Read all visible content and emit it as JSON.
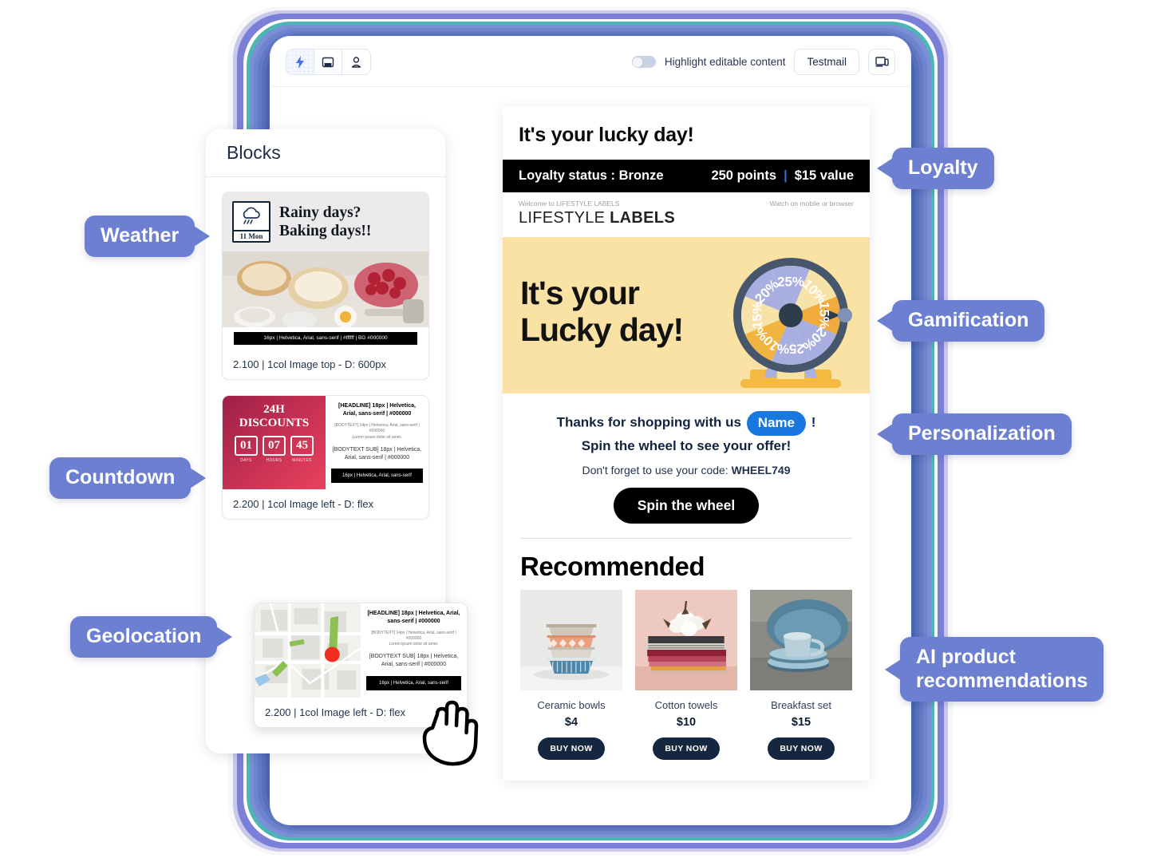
{
  "toolbar": {
    "segments": [
      {
        "name": "bolt-icon",
        "label": "Automation"
      },
      {
        "name": "screen-icon",
        "label": "Desktop preview"
      },
      {
        "name": "person-icon",
        "label": "Personalize"
      }
    ],
    "toggle_label": "Highlight editable content",
    "testmail_label": "Testmail",
    "device_icon_label": "Device preview"
  },
  "blocks_panel": {
    "title": "Blocks",
    "weather_block": {
      "date": "11 Mon",
      "headline_line1": "Rainy days?",
      "headline_line2": "Baking days!!",
      "tag": "16px | Helvetica, Arial, sans-serif | #ffffff | BG #000000",
      "caption": "2.100 | 1col Image top - D: 600px"
    },
    "countdown_block": {
      "title_line1": "24H",
      "title_line2": "DISCOUNTS",
      "units": [
        {
          "value": "01",
          "label": "DAYS"
        },
        {
          "value": "07",
          "label": "HOURS"
        },
        {
          "value": "45",
          "label": "MINUTES"
        }
      ],
      "headline": "[HEADLINE] 18px | Helvetica, Arial, sans-serif | #000000",
      "bodytext": "[BODYTEXT] 14px | Helvetica, Arial, sans-serif | #000000\nLorem ipsum dolor sit amet.",
      "bodytext_sub": "[BODYTEXT SUB] 18px | Helvetica, Arial, sans-serif | #000000",
      "tag": "16px | Helvetica, Arial, sans-serif",
      "caption": "2.200 | 1col Image left - D: flex"
    },
    "geolocation_block": {
      "headline": "[HEADLINE] 18px | Helvetica, Arial, sans-serif | #000000",
      "bodytext": "[BODYTEXT] 14px | Helvetica, Arial, sans-serif | #000000\nLorem ipsum dolor sit amet.",
      "bodytext_sub": "[BODYTEXT SUB] 18px | Helvetica, Arial, sans-serif | #000000",
      "tag": "16px | Helvetica, Arial, sans-serif",
      "caption": "2.200 | 1col Image left - D: flex"
    }
  },
  "email": {
    "hero_title": "It's your lucky day!",
    "loyalty_status": "Loyalty status : Bronze",
    "loyalty_points": "250 points",
    "loyalty_separator": "|",
    "loyalty_value": "$15 value",
    "meta_left": "Welcome to LIFESTYLE LABELS",
    "meta_right": "Watch on mobile or browser",
    "brand_light": "LIFESTYLE",
    "brand_bold": "LABELS",
    "banner_line1": "It's your",
    "banner_line2": "Lucky day!",
    "wheel_segments": [
      "25%",
      "10%",
      "15%",
      "20%",
      "25%",
      "10%",
      "15%",
      "20%"
    ],
    "thanks_prefix": "Thanks for shopping with us",
    "thanks_name_pill": "Name",
    "thanks_suffix": "!",
    "thanks_line2": "Spin the wheel to see your offer!",
    "code_prefix": "Don't forget to use your code:",
    "code_value": "WHEEL749",
    "spin_button": "Spin the wheel",
    "recommended_title": "Recommended",
    "products": [
      {
        "name": "Ceramic bowls",
        "price": "$4",
        "cta": "BUY NOW"
      },
      {
        "name": "Cotton towels",
        "price": "$10",
        "cta": "BUY NOW"
      },
      {
        "name": "Breakfast set",
        "price": "$15",
        "cta": "BUY NOW"
      }
    ]
  },
  "callouts": {
    "weather": "Weather",
    "countdown": "Countdown",
    "geolocation": "Geolocation",
    "loyalty": "Loyalty",
    "gamification": "Gamification",
    "personalization": "Personalization",
    "ai_recommendations": "AI product\nrecommendations"
  },
  "colors": {
    "callout_bg": "#6c7fd0",
    "banner_bg": "#fae2a5",
    "pill_blue": "#1878e0",
    "loyalty_bar": "#000000",
    "buy_button": "#152740"
  }
}
